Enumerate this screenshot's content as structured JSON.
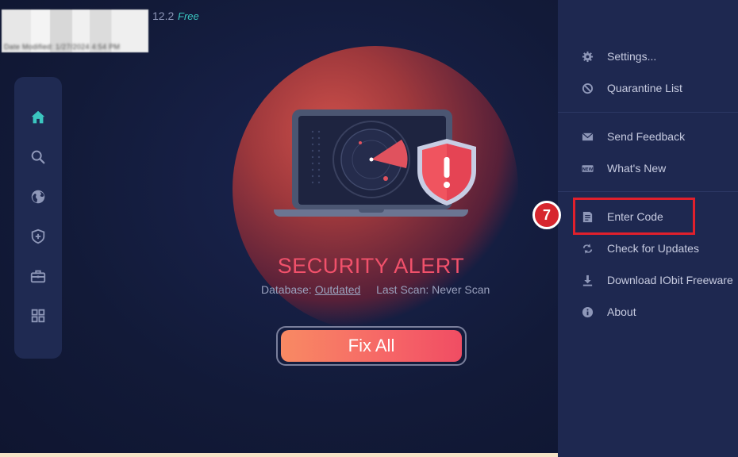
{
  "app": {
    "title_blurred": "IObit Malware Fighter",
    "version": "12.2",
    "edition": "Free",
    "blurred_date_line": "Date Modified: 1/27/2024 4:54 PM"
  },
  "side_nav": {
    "items": [
      {
        "name": "home",
        "icon": "home-icon"
      },
      {
        "name": "scan",
        "icon": "search-icon"
      },
      {
        "name": "browser-protection",
        "icon": "globe-icon"
      },
      {
        "name": "protection",
        "icon": "shield-plus-icon"
      },
      {
        "name": "toolbox",
        "icon": "toolbox-icon"
      },
      {
        "name": "more-tools",
        "icon": "grid-icon"
      }
    ]
  },
  "main": {
    "alert_title": "SECURITY ALERT",
    "database_label": "Database:",
    "database_status": "Outdated",
    "last_scan_label": "Last Scan:",
    "last_scan_value": "Never Scan",
    "fix_button": "Fix All"
  },
  "menu": {
    "items": [
      {
        "label": "Settings...",
        "icon": "gear-icon"
      },
      {
        "label": "Quarantine List",
        "icon": "ban-icon"
      },
      {
        "label": "Send Feedback",
        "icon": "envelope-icon"
      },
      {
        "label": "What's New",
        "icon": "new-badge-icon"
      },
      {
        "label": "Enter Code",
        "icon": "document-icon"
      },
      {
        "label": "Check for Updates",
        "icon": "refresh-icon"
      },
      {
        "label": "Download IObit Freeware",
        "icon": "download-icon"
      },
      {
        "label": "About",
        "icon": "info-icon"
      }
    ]
  },
  "annotation": {
    "step_number": "7"
  },
  "colors": {
    "accent": "#f1516b",
    "teal": "#3bc6c0",
    "highlight": "#e0202c"
  }
}
